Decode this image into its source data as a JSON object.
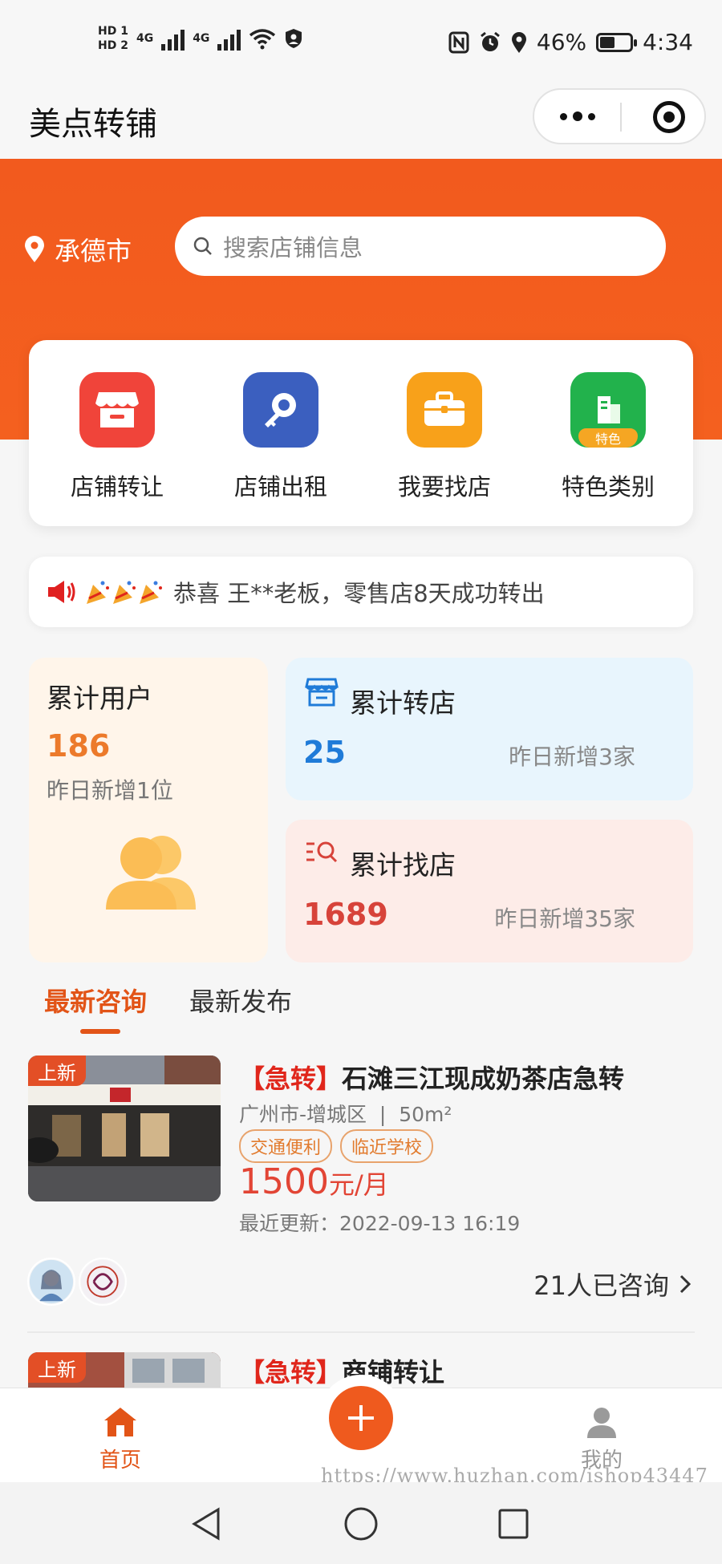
{
  "status_bar": {
    "hd1": "HD 1",
    "hd2": "HD 2",
    "net1": "4G",
    "net2": "4G",
    "battery": "46%",
    "time": "4:34"
  },
  "nav": {
    "title": "美点转铺"
  },
  "header": {
    "city": "承德市",
    "search_placeholder": "搜索店铺信息",
    "accent": "#f25a1e"
  },
  "quick_actions": [
    {
      "label": "店铺转让",
      "icon": "storefront-icon",
      "color": "#f0443a"
    },
    {
      "label": "店铺出租",
      "icon": "key-icon",
      "color": "#3b5fbf"
    },
    {
      "label": "我要找店",
      "icon": "briefcase-icon",
      "color": "#f8a11a"
    },
    {
      "label": "特色类别",
      "icon": "building-icon",
      "color": "#22b24c",
      "badge": "特色"
    }
  ],
  "notice": {
    "text": "恭喜 王**老板，零售店8天成功转出"
  },
  "stats": {
    "users": {
      "title": "累计用户",
      "value": "186",
      "sub": "昨日新增1位"
    },
    "transfers": {
      "title": "累计转店",
      "value": "25",
      "sub": "昨日新增3家"
    },
    "finds": {
      "title": "累计找店",
      "value": "1689",
      "sub": "昨日新增35家"
    }
  },
  "tabs": {
    "active": "最新咨询",
    "other": "最新发布"
  },
  "listings": [
    {
      "badge": "上新",
      "tag": "【急转】",
      "title": "石滩三江现成奶茶店急转",
      "location": "广州市-增城区",
      "area": "50m²",
      "chips": [
        "交通便利",
        "临近学校"
      ],
      "price": "1500",
      "price_unit": "元/月",
      "updated_label": "最近更新：",
      "updated": "2022-09-13 16:19",
      "consult": "21人已咨询"
    },
    {
      "badge": "上新",
      "tag": "【急转】",
      "title": "商铺转让"
    }
  ],
  "tabbar": {
    "home": "首页",
    "mine": "我的"
  },
  "watermark": "https://www.huzhan.com/ishop43447"
}
